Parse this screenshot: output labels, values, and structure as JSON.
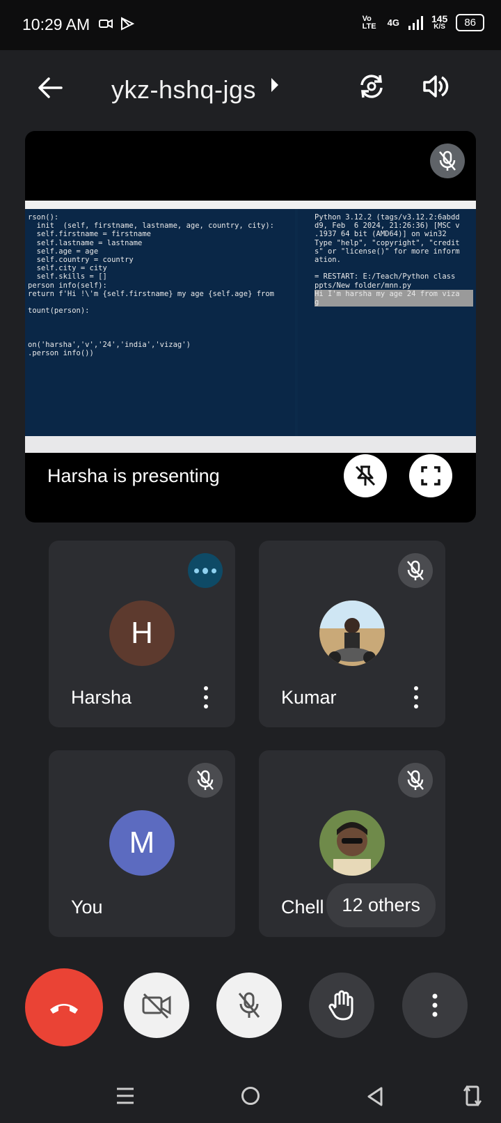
{
  "status": {
    "time": "10:29 AM",
    "network_label": "Vo LTE",
    "network_type": "4G",
    "speed_value": "145",
    "speed_unit": "K/S",
    "battery": "86"
  },
  "header": {
    "meeting_code": "ykz-hshq-jgs",
    "icons": [
      "back-arrow-icon",
      "switch-camera-icon",
      "speaker-icon"
    ]
  },
  "presentation": {
    "label": "Harsha is presenting",
    "code_left": [
      "rson():",
      "  init  (self, firstname, lastname, age, country, city):",
      "  self.firstname = firstname",
      "  self.lastname = lastname",
      "  self.age = age",
      "  self.country = country",
      "  self.city = city",
      "  self.skills = []",
      "person info(self):",
      "return f'Hi !\\'m {self.firstname} my age {self.age} from",
      "",
      "tount(person):",
      "",
      "",
      "",
      "on('harsha','v','24','india','vizag')",
      ".person info())"
    ],
    "code_right": [
      "Python 3.12.2 (tags/v3.12.2:6abdd",
      "d9, Feb  6 2024, 21:26:36) [MSC v",
      ".1937 64 bit (AMD64)] on win32",
      "Type \"help\", \"copyright\", \"credit",
      "s\" or \"license()\" for more inform",
      "ation.",
      "",
      "= RESTART: E:/Teach/Python class",
      "ppts/New folder/mnn.py",
      "Hi I'm harsha my age 24 from viza",
      "g"
    ]
  },
  "participants": [
    {
      "name": "Harsha",
      "initial": "H",
      "avatar_color": "#5d3a2e",
      "state": "speaking"
    },
    {
      "name": "Kumar",
      "state": "muted",
      "photo": true
    },
    {
      "name": "You",
      "initial": "M",
      "avatar_color": "#5c6bc0",
      "state": "muted"
    },
    {
      "name": "Chell",
      "state": "muted",
      "photo": true
    }
  ],
  "others_label": "12 others",
  "controls": [
    "end-call",
    "camera-off",
    "mic-off",
    "raise-hand",
    "more-options"
  ],
  "colors": {
    "end_call": "#ea4335",
    "background": "#1f2023",
    "tile": "#2c2d31"
  }
}
